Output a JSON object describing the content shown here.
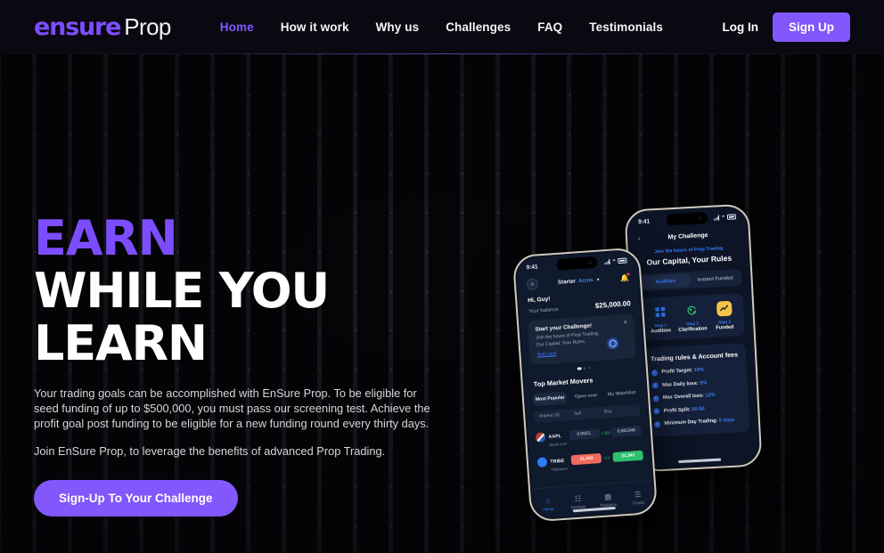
{
  "brand": {
    "mark": "ensure",
    "word": "Prop"
  },
  "nav": {
    "links": [
      {
        "label": "Home",
        "active": true
      },
      {
        "label": "How it work",
        "active": false
      },
      {
        "label": "Why us",
        "active": false
      },
      {
        "label": "Challenges",
        "active": false
      },
      {
        "label": "FAQ",
        "active": false
      },
      {
        "label": "Testimonials",
        "active": false
      }
    ],
    "login_label": "Log In",
    "signup_label": "Sign Up",
    "accent_color": "#8257fb"
  },
  "hero": {
    "headline_accent": "EARN",
    "headline_line2": "WHILE YOU",
    "headline_line3": "LEARN",
    "paragraph1": "Your trading goals can be accomplished with EnSure Prop. To be eligible for seed funding of up to $500,000, you must pass our screening test. Achieve the profit goal post funding to be eligible for a new funding round every thirty days.",
    "paragraph2": "Join EnSure Prop, to leverage the benefits of advanced Prop Trading.",
    "cta_label": "Sign-Up To Your Challenge"
  },
  "phone_front": {
    "status": {
      "time": "9:41",
      "wifi": "●",
      "battery": "battery-icon"
    },
    "avatar_initial": "A",
    "plan_label": "Starter",
    "plan_tag": "Acms",
    "greeting": "Hi, Guy!",
    "balance_label": "Your balance",
    "balance_value": "$25,000.00",
    "promo": {
      "title": "Start your Challenge!",
      "line1": "Join the future of Prop Trading,",
      "line2": "Our Capital, Your Rules.",
      "link": "Start now",
      "close": "✕"
    },
    "section_title": "Top Market Movers",
    "segments": [
      {
        "label": "Most Popular",
        "active": true
      },
      {
        "label": "Open now",
        "active": false
      },
      {
        "label": "My Watchlist",
        "active": false
      }
    ],
    "table_headers": [
      "Market (6)",
      "Sell",
      "Buy"
    ],
    "rows": [
      {
        "symbol": "AAPL",
        "company": "Apple.com",
        "sell": "0.0023..",
        "delta": "1.580",
        "buy": "0.002348",
        "sell_style": "plain",
        "buy_style": "plain",
        "icon_color": "#d6443c"
      },
      {
        "symbol": "TRIBE",
        "company": "Tribestore",
        "sell": "21,343",
        "delta": "0.2",
        "buy": "21,343",
        "sell_style": "red",
        "buy_style": "green",
        "icon_color": "#2f7bf6"
      }
    ],
    "tabs": [
      {
        "label": "Home",
        "icon": "⌂",
        "active": true
      },
      {
        "label": "Markets",
        "icon": "☷",
        "active": false
      },
      {
        "label": "Positions",
        "icon": "▦",
        "active": false
      },
      {
        "label": "Funds",
        "icon": "☰",
        "active": false
      }
    ]
  },
  "phone_back": {
    "status": {
      "time": "9:41"
    },
    "back_icon": "‹",
    "title": "My Challenge",
    "eyebrow": "Join the future of Prop Trading",
    "heading": "Our Capital, Your Rules",
    "segments": [
      {
        "label": "Audition",
        "active": true
      },
      {
        "label": "Instant Funded",
        "active": false
      }
    ],
    "steps": [
      {
        "step": "Step 1",
        "label": "Audition",
        "icon": "⬚",
        "bg": "#14213a",
        "color": "#2f7bf6"
      },
      {
        "step": "Step 2",
        "label": "Clarification",
        "icon": "↻",
        "bg": "#14213a",
        "color": "#2fbf6e"
      },
      {
        "step": "Step 3",
        "label": "Funded",
        "icon": "↗",
        "bg": "#f2c34b",
        "color": "#1c1a10"
      }
    ],
    "rules_title": "Trading rules & Account fees",
    "rules": [
      {
        "label": "Profit Target:",
        "value": "10%"
      },
      {
        "label": "Max Daily loss:",
        "value": "5%"
      },
      {
        "label": "Max Overall loss:",
        "value": "12%"
      },
      {
        "label": "Profit Split:",
        "value": "50-50"
      },
      {
        "label": "Minimum Day Trading:",
        "value": "5 days"
      }
    ],
    "check_glyph": "✓"
  }
}
